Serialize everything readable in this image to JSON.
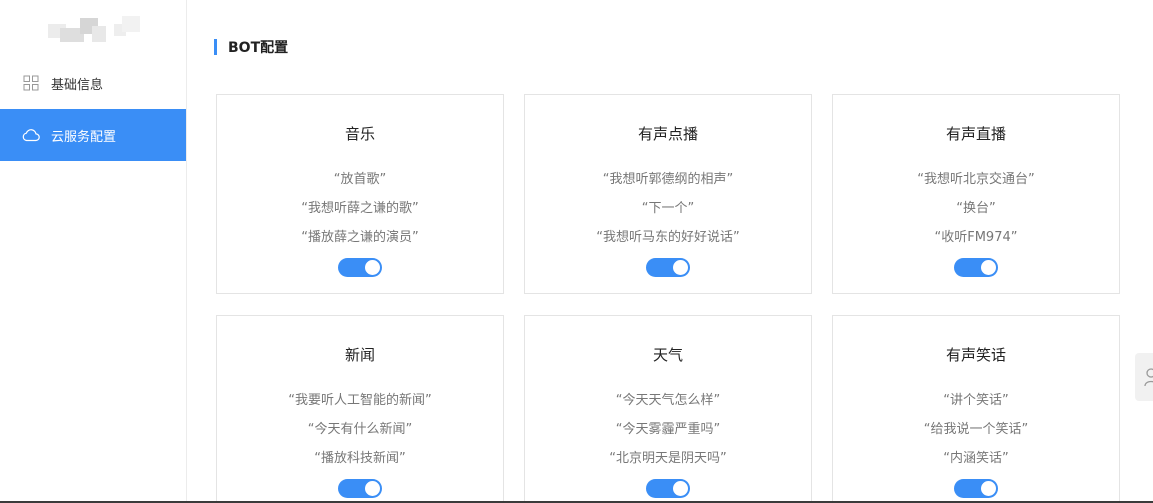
{
  "sidebar": {
    "items": [
      {
        "label": "基础信息",
        "icon": "grid-icon",
        "active": false
      },
      {
        "label": "云服务配置",
        "icon": "cloud-icon",
        "active": true
      }
    ]
  },
  "main": {
    "section_title": "BOT配置",
    "cards": [
      {
        "title": "音乐",
        "examples": [
          "“放首歌”",
          "“我想听薛之谦的歌”",
          "“播放薛之谦的演员”"
        ],
        "enabled": true
      },
      {
        "title": "有声点播",
        "examples": [
          "“我想听郭德纲的相声”",
          "“下一个”",
          "“我想听马东的好好说话”"
        ],
        "enabled": true
      },
      {
        "title": "有声直播",
        "examples": [
          "“我想听北京交通台”",
          "“换台”",
          "“收听FM974”"
        ],
        "enabled": true
      },
      {
        "title": "新闻",
        "examples": [
          "“我要听人工智能的新闻”",
          "“今天有什么新闻”",
          "“播放科技新闻”"
        ],
        "enabled": true
      },
      {
        "title": "天气",
        "examples": [
          "“今天天气怎么样”",
          "“今天雾霾严重吗”",
          "“北京明天是阴天吗”"
        ],
        "enabled": true
      },
      {
        "title": "有声笑话",
        "examples": [
          "“讲个笑话”",
          "“给我说一个笑话”",
          "“内涵笑话”"
        ],
        "enabled": true
      }
    ]
  },
  "colors": {
    "accent": "#3a8ef6",
    "border": "#e4e4e4",
    "text_muted": "#777777"
  }
}
